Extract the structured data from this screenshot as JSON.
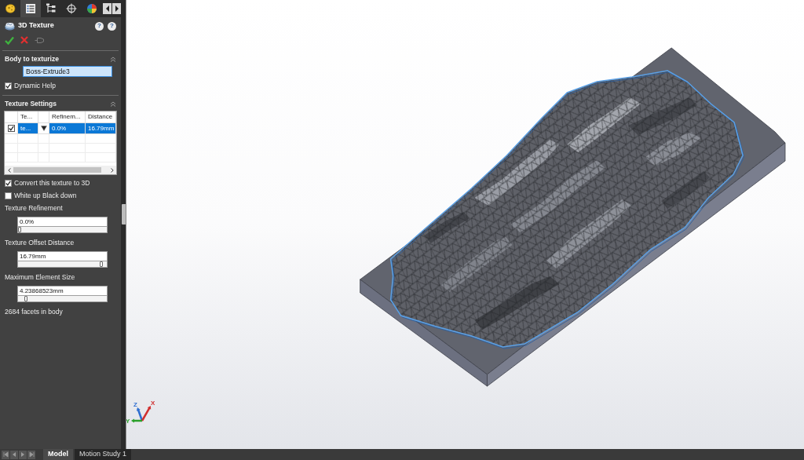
{
  "panel": {
    "tabs": [
      {
        "selected": false
      },
      {
        "selected": true
      },
      {
        "selected": false
      },
      {
        "selected": false
      },
      {
        "selected": false
      }
    ],
    "title": "3D Texture",
    "help_buttons": [
      "?",
      "?"
    ],
    "actions": [
      {
        "kind": "ok",
        "disabled": false
      },
      {
        "kind": "cancel",
        "disabled": false
      },
      {
        "kind": "pin",
        "disabled": true
      }
    ],
    "body_section": {
      "title": "Body to texturize",
      "expanded": true,
      "field": {
        "value": "Boss-Extrude3",
        "active": true
      },
      "dynamic_help": {
        "label": "Dynamic Help",
        "checked": true
      }
    },
    "texture_section": {
      "title": "Texture Settings",
      "expanded": true,
      "table": {
        "columns": [
          "Te...",
          "Refinem...",
          "Distance"
        ],
        "rows": [
          {
            "checked": true,
            "selected": true,
            "cells": [
              "te...",
              "0.0%",
              "16.79mm"
            ]
          }
        ]
      },
      "options": [
        {
          "label": "Convert this texture to 3D",
          "checked": true
        },
        {
          "label": "White up Black down",
          "checked": false
        }
      ],
      "sliders": [
        {
          "label": "Texture Refinement",
          "value": "0.0%",
          "level": 0
        },
        {
          "label": "Texture Offset Distance",
          "value": "16.79mm",
          "level": 0.95
        },
        {
          "label": "Maximum Element Size",
          "value": "4.23868523mm",
          "level": 0.07
        }
      ],
      "facet_count": "2684 facets in body"
    }
  },
  "viewport": {
    "triad": {
      "axes": [
        {
          "label": "Z",
          "color": "#2f6fd0"
        },
        {
          "label": "X",
          "color": "#d03030"
        },
        {
          "label": "Y",
          "color": "#2aa02a"
        }
      ]
    }
  },
  "bottom_tabs": [
    {
      "label": "Model",
      "selected": true
    },
    {
      "label": "Motion Study 1",
      "selected": false
    }
  ]
}
